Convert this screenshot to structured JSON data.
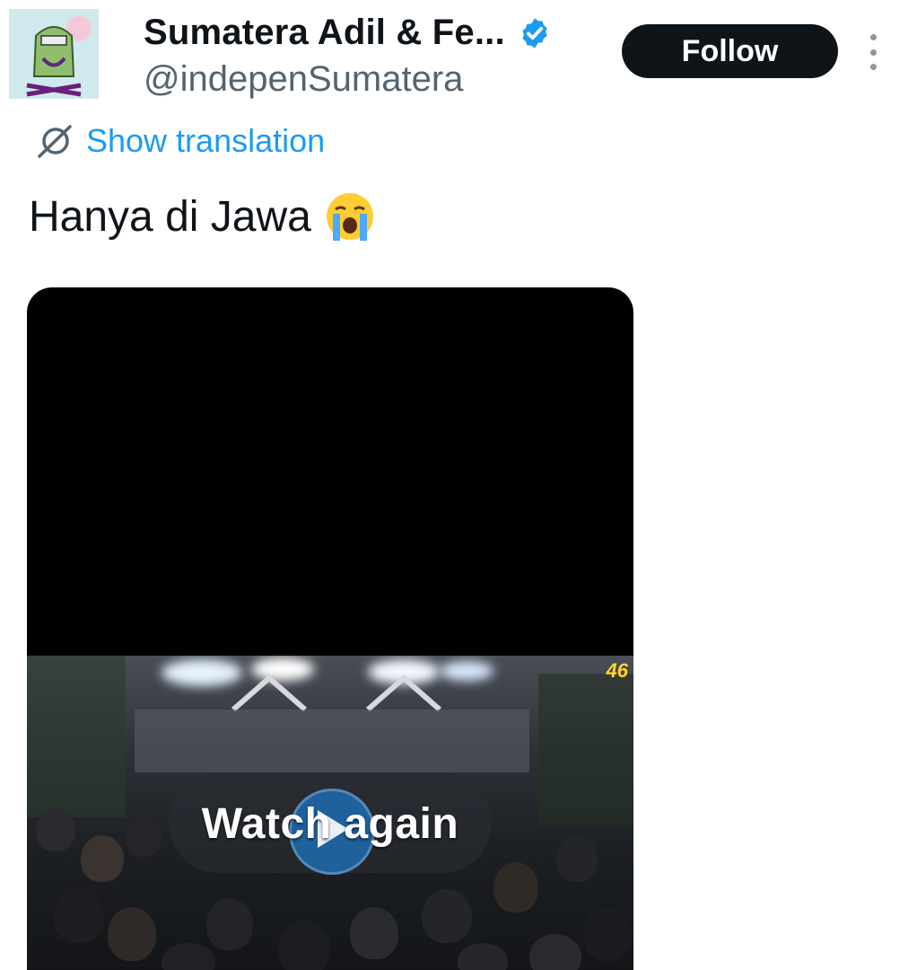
{
  "header": {
    "display_name": "Sumatera Adil & Fe...",
    "handle": "@indepenSumatera",
    "follow_label": "Follow",
    "verified_color": "#1d9bf0"
  },
  "translate": {
    "label": "Show translation"
  },
  "tweet": {
    "text": "Hanya di Jawa",
    "emoji": "crying-face"
  },
  "video": {
    "replay_label": "Watch again",
    "watermark": "46"
  },
  "colors": {
    "accent": "#1d9bf0",
    "text": "#0f1419",
    "muted": "#536471"
  }
}
